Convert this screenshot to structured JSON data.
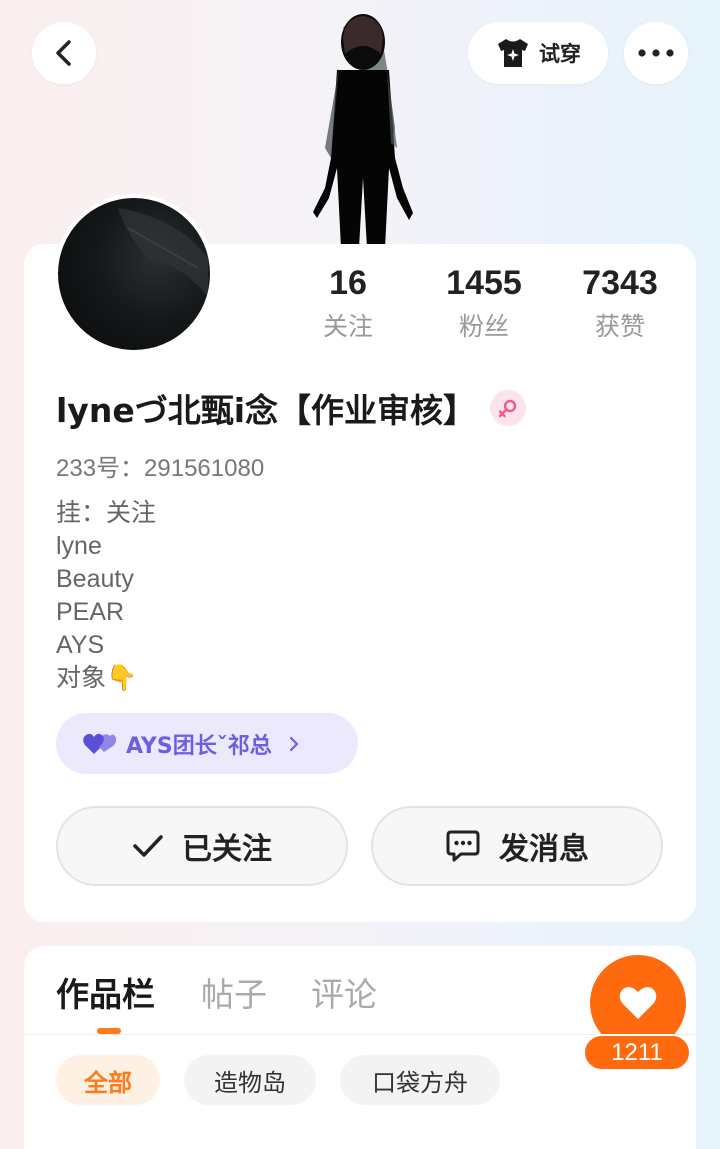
{
  "header": {
    "try_on_label": "试穿"
  },
  "profile": {
    "stats": [
      {
        "value": "16",
        "label": "关注"
      },
      {
        "value": "1455",
        "label": "粉丝"
      },
      {
        "value": "7343",
        "label": "获赞"
      }
    ],
    "username": "lyneづ北甄i念【作业审核】",
    "gender_icon": "female-icon",
    "uid_text": "233号：291561080",
    "bio_lines": [
      "挂：关注",
      "lyne",
      "Beauty",
      "PEAR",
      "AYS",
      "对象👇"
    ],
    "group": {
      "label": "AYS团长ˇ祁总",
      "icon": "hearts-icon"
    },
    "follow_label": "已关注",
    "message_label": "发消息"
  },
  "tabs": [
    "作品栏",
    "帖子",
    "评论"
  ],
  "active_tab": 0,
  "filters": [
    "全部",
    "造物岛",
    "口袋方舟"
  ],
  "active_filter": 0,
  "like_count": "1211",
  "colors": {
    "accent_orange": "#ff6a0f",
    "group_purple": "#6a5fe0",
    "group_bg": "#ece9fc"
  }
}
